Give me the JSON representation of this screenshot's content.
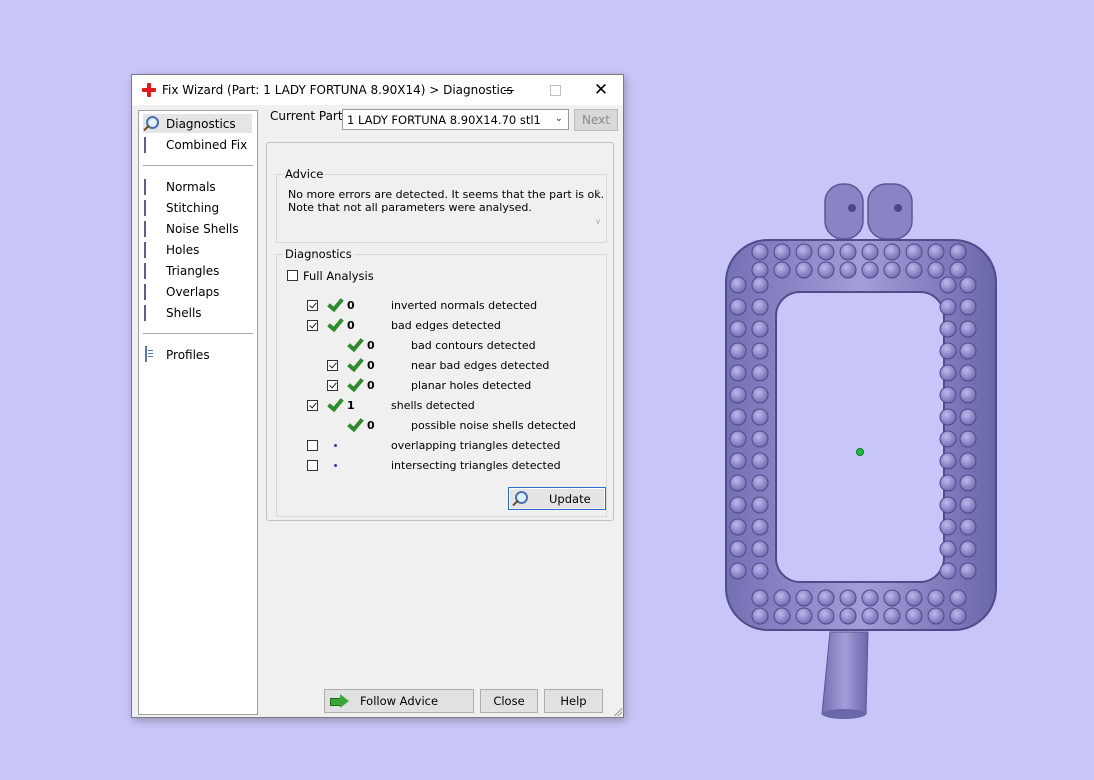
{
  "window": {
    "title": "Fix Wizard (Part: 1 LADY FORTUNA  8.90X14) > Diagnostics",
    "minimize_icon": "minimize-icon",
    "maximize_icon": "maximize-icon",
    "close_glyph": "✕"
  },
  "sidebar": {
    "items": [
      {
        "label": "Diagnostics",
        "icon": "magnifier-icon",
        "selected": true
      },
      {
        "label": "Combined Fix",
        "icon": "cube-icon"
      },
      {
        "label": "Normals",
        "icon": "cube-red-face-icon"
      },
      {
        "label": "Stitching",
        "icon": "cube-icon"
      },
      {
        "label": "Noise Shells",
        "icon": "cube-dots-icon"
      },
      {
        "label": "Holes",
        "icon": "cube-red-icon"
      },
      {
        "label": "Triangles",
        "icon": "cube-triangle-icon"
      },
      {
        "label": "Overlaps",
        "icon": "cube-icon"
      },
      {
        "label": "Shells",
        "icon": "cube-icon"
      },
      {
        "label": "Profiles",
        "icon": "document-icon"
      }
    ]
  },
  "part": {
    "label": "Current Part:",
    "selected": "1 LADY FORTUNA  8.90X14.70 stl1",
    "next_label": "Next"
  },
  "advice": {
    "group_label": "Advice",
    "text": "No more errors are detected. It seems that the part is ok.\nNote that not all parameters were analysed."
  },
  "diagnostics": {
    "group_label": "Diagnostics",
    "full_analysis_label": "Full Analysis",
    "full_analysis_checked": false,
    "rows": [
      {
        "checked": true,
        "status": "ok",
        "count": "0",
        "label": "inverted normals detected"
      },
      {
        "checked": true,
        "status": "ok",
        "count": "0",
        "label": "bad edges detected"
      },
      {
        "checked": null,
        "status": "ok",
        "count": "0",
        "label": "bad contours detected"
      },
      {
        "checked": true,
        "status": "ok",
        "count": "0",
        "label": "near bad edges detected"
      },
      {
        "checked": true,
        "status": "ok",
        "count": "0",
        "label": "planar holes detected"
      },
      {
        "checked": true,
        "status": "ok",
        "count": "1",
        "label": "shells detected"
      },
      {
        "checked": null,
        "status": "ok",
        "count": "0",
        "label": "possible noise shells detected"
      },
      {
        "checked": false,
        "status": "none",
        "count": "",
        "label": "overlapping triangles detected"
      },
      {
        "checked": false,
        "status": "none",
        "count": "",
        "label": "intersecting triangles detected"
      }
    ],
    "update_label": "Update"
  },
  "buttons": {
    "follow_advice": "Follow Advice",
    "close": "Close",
    "help": "Help"
  },
  "colors": {
    "background": "#c8c6f8",
    "model": "#8e8ac8",
    "check_green": "#2e8b2e"
  }
}
